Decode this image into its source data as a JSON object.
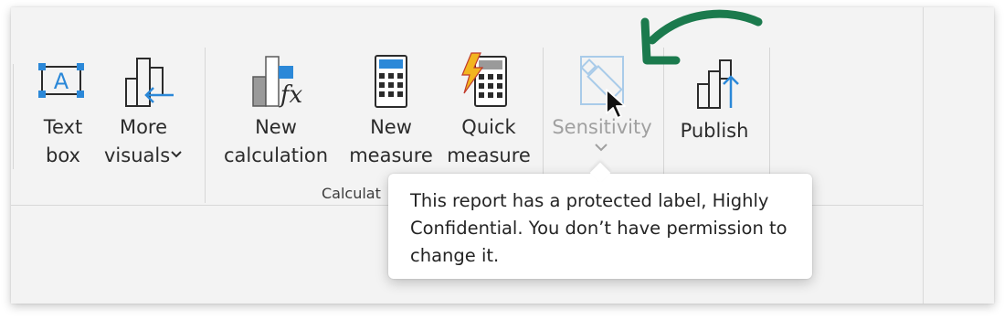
{
  "ribbon": {
    "buttons": [
      {
        "label_line1": "Text",
        "label_line2": "box",
        "icon": "text-box-icon"
      },
      {
        "label_line1": "More",
        "label_line2": "visuals",
        "icon": "more-visuals-icon",
        "dropdown_icon": "chevron-down-icon"
      },
      {
        "label_line1": "New",
        "label_line2": "calculation",
        "icon": "new-calculation-icon"
      },
      {
        "label_line1": "New",
        "label_line2": "measure",
        "icon": "calculator-icon"
      },
      {
        "label_line1": "Quick",
        "label_line2": "measure",
        "icon": "quick-measure-icon"
      },
      {
        "label_line1": "Sensitivity",
        "icon": "sensitivity-label-icon",
        "dropdown_icon": "chevron-down-icon",
        "state": "disabled"
      },
      {
        "label_line1": "Publish",
        "icon": "publish-icon"
      }
    ],
    "group_label": "Calculat"
  },
  "tooltip": {
    "text": "This report has a protected label, Highly Confidential. You don’t have permission to change it."
  },
  "annotation": {
    "arrow_icon": "curved-arrow-icon",
    "arrow_color": "#1b7a4d"
  },
  "colors": {
    "accent_blue": "#2b88d8",
    "disabled_gray": "#a0a0a0",
    "calc_yellow": "#f2b51f"
  }
}
